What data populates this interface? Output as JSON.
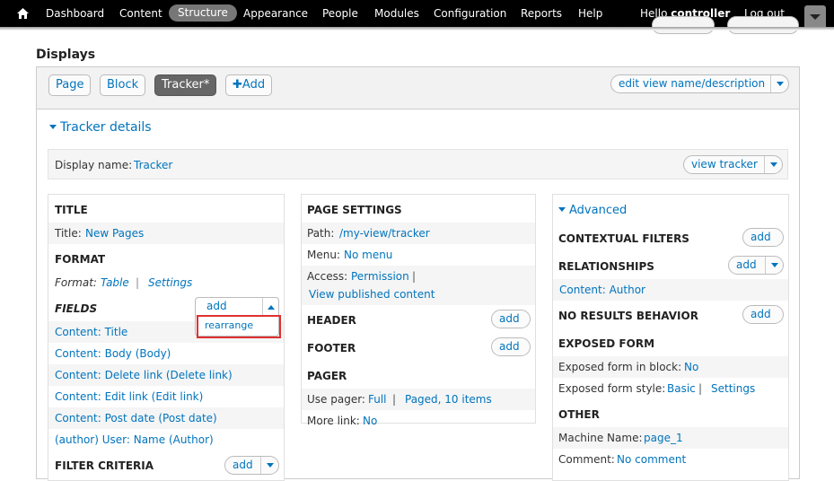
{
  "toolbar": {
    "items": [
      "Dashboard",
      "Content",
      "Structure",
      "Appearance",
      "People",
      "Modules",
      "Configuration",
      "Reports",
      "Help"
    ],
    "hello_prefix": "Hello",
    "username": "controller",
    "logout": "Log out"
  },
  "page": {
    "displays_title": "Displays"
  },
  "tabs": {
    "page": "Page",
    "block": "Block",
    "tracker": "Tracker*",
    "add": "Add"
  },
  "edit_view_label": "edit view name/description",
  "details": {
    "section_title": "Tracker details",
    "display_name_label": "Display name:",
    "display_name_value": "Tracker",
    "view_button": "view tracker"
  },
  "col1": {
    "title_header": "TITLE",
    "title_label": "Title:",
    "title_value": "New Pages",
    "format_header": "FORMAT",
    "format_label": "Format:",
    "format_value": "Table",
    "format_settings": "Settings",
    "fields_header": "FIELDS",
    "fields_add": "add",
    "fields_rearrange": "rearrange",
    "fields": [
      "Content: Title",
      "Content: Body (Body)",
      "Content: Delete link (Delete link)",
      "Content: Edit link (Edit link)",
      "Content: Post date (Post date)",
      "(author) User: Name (Author)"
    ],
    "filter_header": "FILTER CRITERIA",
    "filter_add": "add"
  },
  "col2": {
    "page_settings_header": "PAGE SETTINGS",
    "path_label": "Path:",
    "path_value": "/my-view/tracker",
    "menu_label": "Menu:",
    "menu_value": "No menu",
    "access_label": "Access:",
    "access_value": "Permission",
    "view_published": "View published content",
    "header_header": "HEADER",
    "header_add": "add",
    "footer_header": "FOOTER",
    "footer_add": "add",
    "pager_header": "PAGER",
    "use_pager_label": "Use pager:",
    "use_pager_value": "Full",
    "paged_value": "Paged, 10 items",
    "more_link_label": "More link:",
    "more_link_value": "No"
  },
  "col3": {
    "advanced": "Advanced",
    "contextual_header": "CONTEXTUAL FILTERS",
    "contextual_add": "add",
    "relationships_header": "RELATIONSHIPS",
    "relationships_add": "add",
    "relationship_item": "Content: Author",
    "no_results_header": "NO RESULTS BEHAVIOR",
    "no_results_add": "add",
    "exposed_header": "EXPOSED FORM",
    "exposed_block_label": "Exposed form in block:",
    "exposed_block_value": "No",
    "exposed_style_label": "Exposed form style:",
    "exposed_style_value": "Basic",
    "exposed_style_settings": "Settings",
    "other_header": "OTHER",
    "machine_label": "Machine Name:",
    "machine_value": "page_1",
    "comment_label": "Comment:",
    "comment_value": "No comment"
  }
}
